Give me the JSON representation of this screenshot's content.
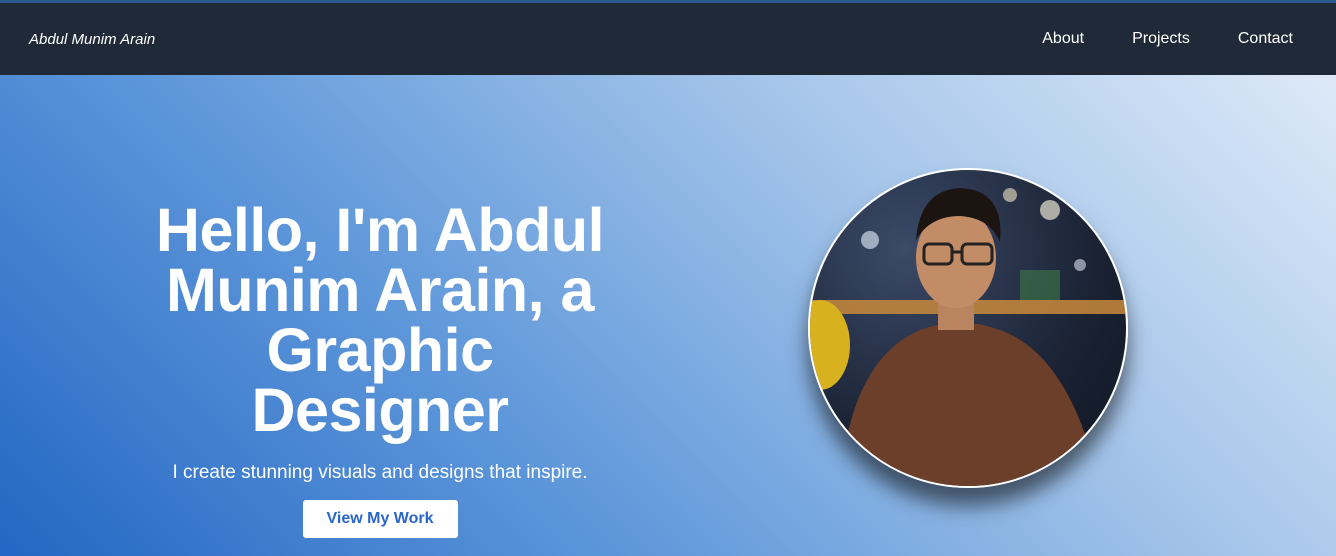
{
  "nav": {
    "brand": "Abdul Munim Arain",
    "links": [
      "About",
      "Projects",
      "Contact"
    ]
  },
  "hero": {
    "title": "Hello, I'm Abdul Munim Arain, a Graphic Designer",
    "subtitle": "I create stunning visuals and designs that inspire.",
    "cta_label": "View My Work"
  },
  "profile_image": {
    "icon": "profile-photo"
  },
  "colors": {
    "navbar": "#1f2937",
    "accent": "#2a66c8"
  }
}
